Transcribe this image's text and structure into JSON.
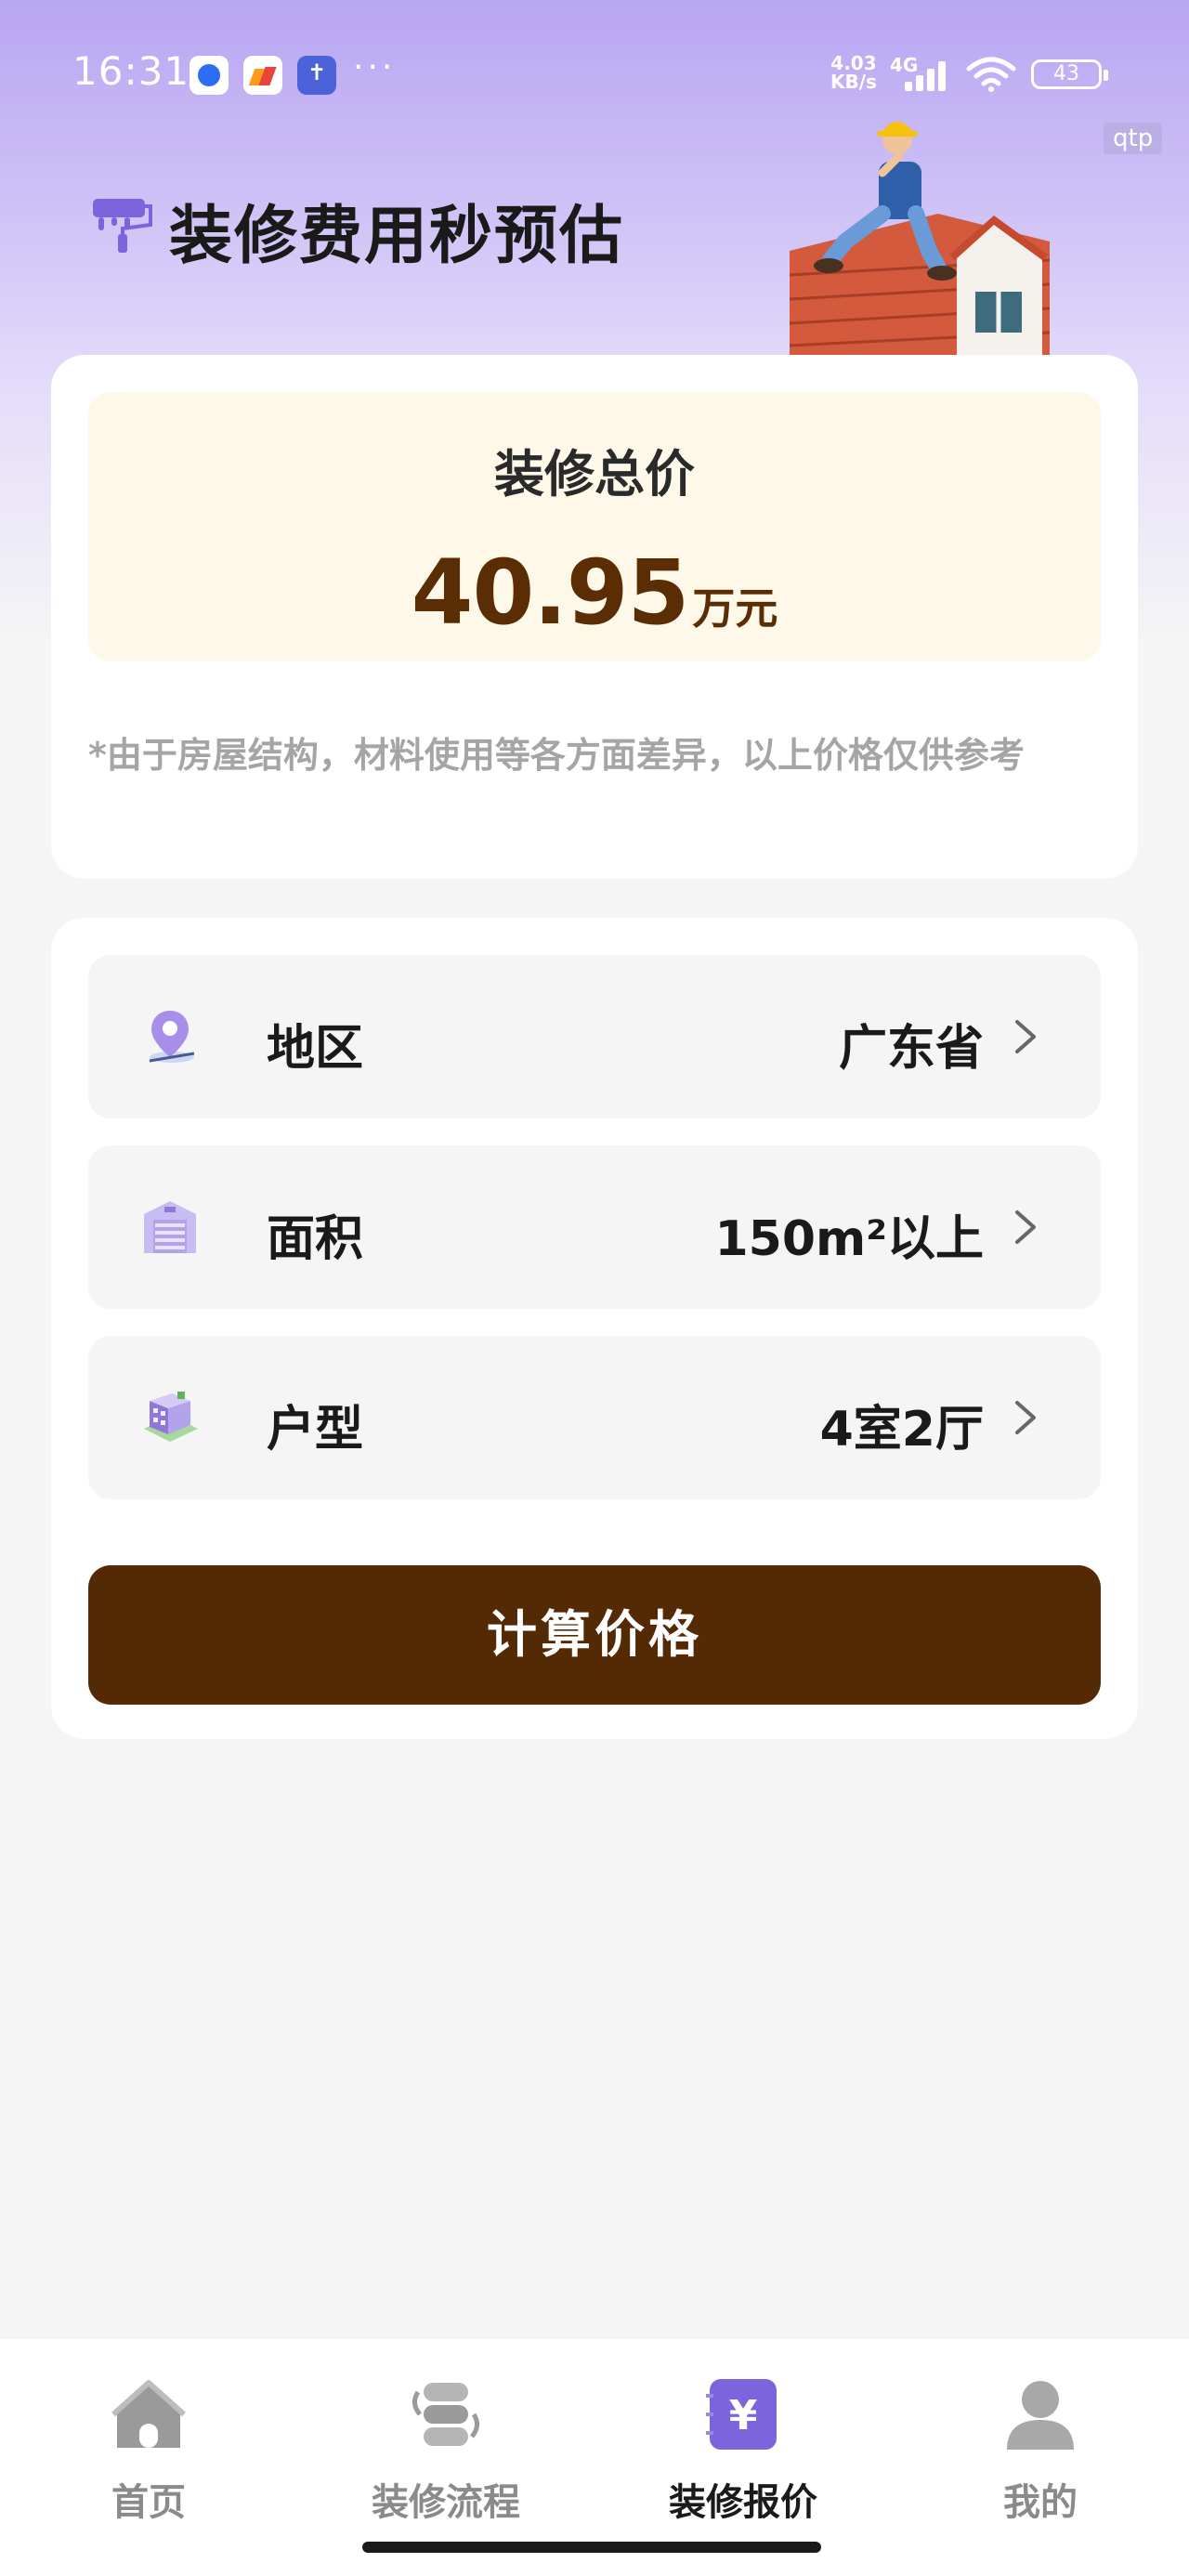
{
  "status_bar": {
    "time": "16:31",
    "net_speed_value": "4.03",
    "net_speed_unit": "KB/s",
    "network_type": "4G",
    "battery": "43",
    "overflow": "···"
  },
  "debug_tag": "qtp",
  "header": {
    "title": "装修费用秒预估"
  },
  "total": {
    "label": "装修总价",
    "value": "40.95",
    "unit": "万元",
    "disclaimer": "*由于房屋结构，材料使用等各方面差异，以上价格仅供参考"
  },
  "form": {
    "region": {
      "label": "地区",
      "value": "广东省",
      "icon": "location-pin-icon"
    },
    "area": {
      "label": "面积",
      "value": "150m²以上",
      "icon": "building-icon"
    },
    "layout": {
      "label": "户型",
      "value": "4室2厅",
      "icon": "apartment-icon"
    },
    "calculate_label": "计算价格"
  },
  "nav": {
    "items": [
      {
        "label": "首页",
        "icon": "home-icon",
        "active": false
      },
      {
        "label": "装修流程",
        "icon": "process-icon",
        "active": false
      },
      {
        "label": "装修报价",
        "icon": "yuan-icon",
        "active": true
      },
      {
        "label": "我的",
        "icon": "user-icon",
        "active": false
      }
    ]
  },
  "colors": {
    "accent": "#7b64dc",
    "brown": "#532a03",
    "total_bg": "#fef8e8"
  }
}
